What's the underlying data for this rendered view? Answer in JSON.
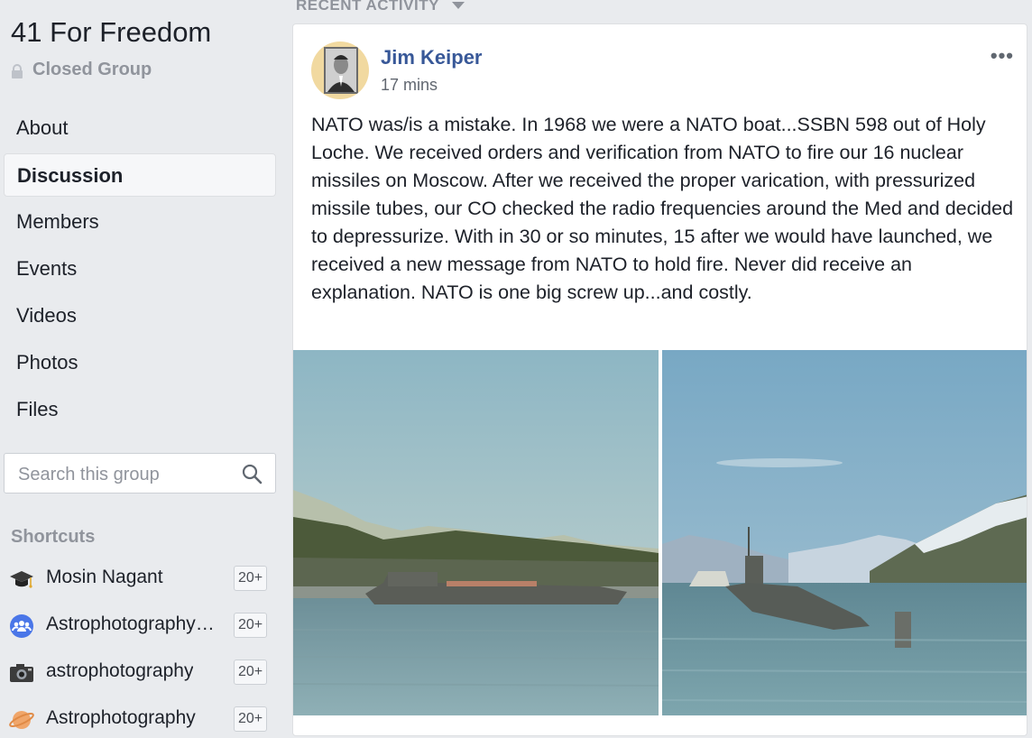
{
  "group": {
    "title": "41 For Freedom",
    "privacy": "Closed Group"
  },
  "nav": [
    {
      "label": "About",
      "active": false
    },
    {
      "label": "Discussion",
      "active": true
    },
    {
      "label": "Members",
      "active": false
    },
    {
      "label": "Events",
      "active": false
    },
    {
      "label": "Videos",
      "active": false
    },
    {
      "label": "Photos",
      "active": false
    },
    {
      "label": "Files",
      "active": false
    }
  ],
  "search": {
    "placeholder": "Search this group"
  },
  "shortcuts": {
    "title": "Shortcuts",
    "items": [
      {
        "label": "Mosin Nagant",
        "count": "20+",
        "icon": "graduation-cap-icon"
      },
      {
        "label": "Astrophotography…",
        "count": "20+",
        "icon": "group-icon"
      },
      {
        "label": "astrophotography",
        "count": "20+",
        "icon": "camera-icon"
      },
      {
        "label": "Astrophotography",
        "count": "20+",
        "icon": "planet-icon"
      }
    ]
  },
  "feed": {
    "sort_label": "RECENT ACTIVITY"
  },
  "post": {
    "author": "Jim Keiper",
    "time": "17 mins",
    "more": "•••",
    "text": "NATO was/is a mistake. In 1968 we were a NATO boat...SSBN 598 out of Holy Loche. We received orders and verification from NATO to fire our 16 nuclear missiles on Moscow. After we received the proper varication, with pressurized missile tubes, our CO checked the radio frequencies around the Med and decided to depressurize. With in 30 or so minutes, 15 after we would have launched, we received a new message from NATO to hold fire. Never did receive an explanation. NATO is one big screw up...and costly."
  },
  "colors": {
    "background": "#e9ebee",
    "link": "#385898",
    "muted": "#90949c",
    "text": "#1d2129"
  }
}
